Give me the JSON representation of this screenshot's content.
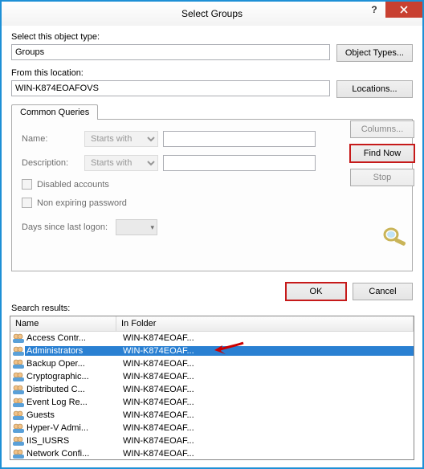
{
  "titlebar": {
    "title": "Select Groups",
    "help": "?"
  },
  "section1": {
    "object_type_label": "Select this object type:",
    "object_type_value": "Groups",
    "object_types_button": "Object Types...",
    "location_label": "From this location:",
    "location_value": "WIN-K874EOAFOVS",
    "locations_button": "Locations..."
  },
  "tab": {
    "label": "Common Queries"
  },
  "query": {
    "name_label": "Name:",
    "name_mode": "Starts with",
    "desc_label": "Description:",
    "desc_mode": "Starts with",
    "disabled_accounts": "Disabled accounts",
    "non_expiring": "Non expiring password",
    "days_label": "Days since last logon:"
  },
  "side": {
    "columns": "Columns...",
    "find_now": "Find Now",
    "stop": "Stop"
  },
  "buttons": {
    "ok": "OK",
    "cancel": "Cancel"
  },
  "results": {
    "label": "Search results:",
    "columns": {
      "name": "Name",
      "folder": "In Folder"
    },
    "folder_value": "WIN-K874EOAF...",
    "items": [
      {
        "name": "Access Contr...",
        "selected": false
      },
      {
        "name": "Administrators",
        "selected": true
      },
      {
        "name": "Backup Oper...",
        "selected": false
      },
      {
        "name": "Cryptographic...",
        "selected": false
      },
      {
        "name": "Distributed C...",
        "selected": false
      },
      {
        "name": "Event Log Re...",
        "selected": false
      },
      {
        "name": "Guests",
        "selected": false
      },
      {
        "name": "Hyper-V Admi...",
        "selected": false
      },
      {
        "name": "IIS_IUSRS",
        "selected": false
      },
      {
        "name": "Network Confi...",
        "selected": false
      }
    ]
  }
}
